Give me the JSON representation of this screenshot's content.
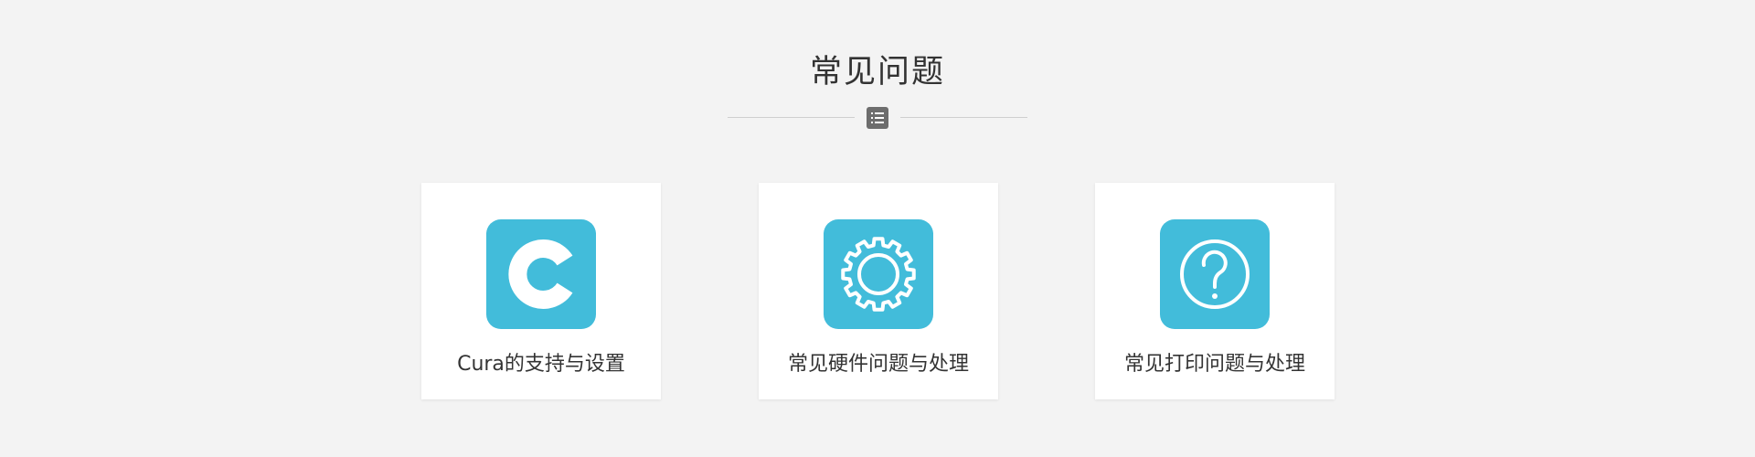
{
  "header": {
    "title": "常见问题",
    "divider_icon": "list-icon"
  },
  "cards": [
    {
      "label": "Cura的支持与设置",
      "icon": "cura-c-icon",
      "icon_bg": "#42bcda"
    },
    {
      "label": "常见硬件问题与处理",
      "icon": "gear-icon",
      "icon_bg": "#42bcda"
    },
    {
      "label": "常见打印问题与处理",
      "icon": "question-mark-icon",
      "icon_bg": "#42bcda"
    }
  ],
  "colors": {
    "background": "#f3f3f3",
    "card": "#ffffff",
    "accent": "#42bcda",
    "text": "#333333",
    "divider_badge": "#6d6d6d"
  }
}
